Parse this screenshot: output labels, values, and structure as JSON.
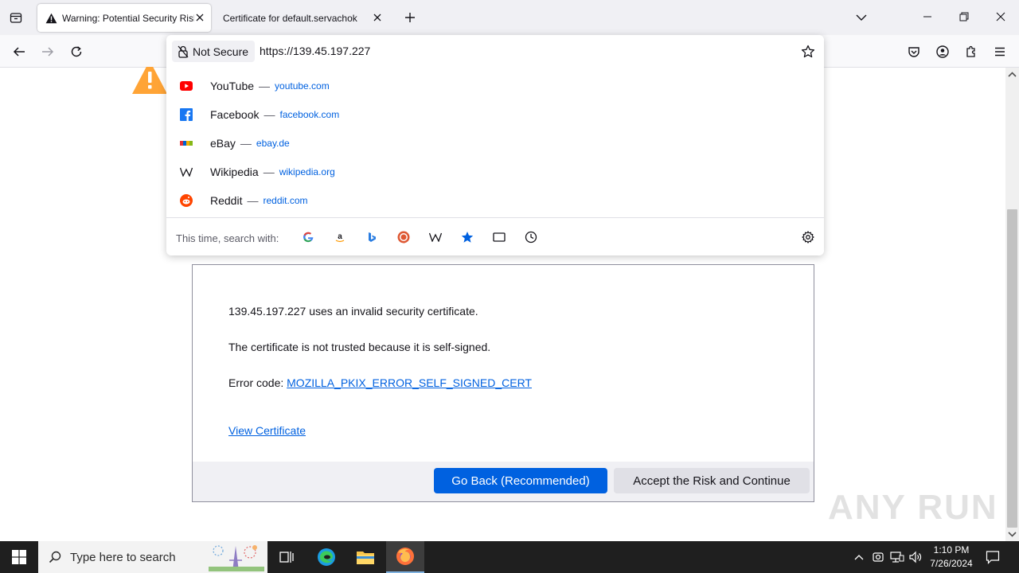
{
  "tabs": [
    {
      "title": "Warning: Potential Security Risk Ahead",
      "icon": "warning-icon",
      "active": true
    },
    {
      "title": "Certificate for default.servachok",
      "icon": "none",
      "active": false
    }
  ],
  "urlbar": {
    "security_label": "Not Secure",
    "url_value": "https://139.45.197.227",
    "suggestions": [
      {
        "title": "YouTube",
        "url": "youtube.com",
        "icon": "youtube-icon"
      },
      {
        "title": "Facebook",
        "url": "facebook.com",
        "icon": "facebook-icon"
      },
      {
        "title": "eBay",
        "url": "ebay.de",
        "icon": "ebay-icon"
      },
      {
        "title": "Wikipedia",
        "url": "wikipedia.org",
        "icon": "wikipedia-icon"
      },
      {
        "title": "Reddit",
        "url": "reddit.com",
        "icon": "reddit-icon"
      }
    ],
    "separator": "—",
    "search_with_label": "This time, search with:",
    "search_engines": [
      "google-icon",
      "amazon-icon",
      "bing-icon",
      "duckduckgo-icon",
      "wikipedia-icon",
      "bookmarks-icon",
      "tabs-icon",
      "history-icon"
    ]
  },
  "advanced_panel": {
    "line1": "139.45.197.227 uses an invalid security certificate.",
    "line2": "The certificate is not trusted because it is self-signed.",
    "error_prefix": "Error code: ",
    "error_code": "MOZILLA_PKIX_ERROR_SELF_SIGNED_CERT",
    "view_certificate": "View Certificate",
    "go_back": "Go Back (Recommended)",
    "accept_risk": "Accept the Risk and Continue"
  },
  "watermark": "ANY RUN",
  "taskbar": {
    "search_placeholder": "Type here to search",
    "time": "1:10 PM",
    "date": "7/26/2024"
  },
  "colors": {
    "accent_blue": "#0061e0",
    "warning_orange": "#ffa436",
    "taskbar": "#1f1f1f"
  }
}
